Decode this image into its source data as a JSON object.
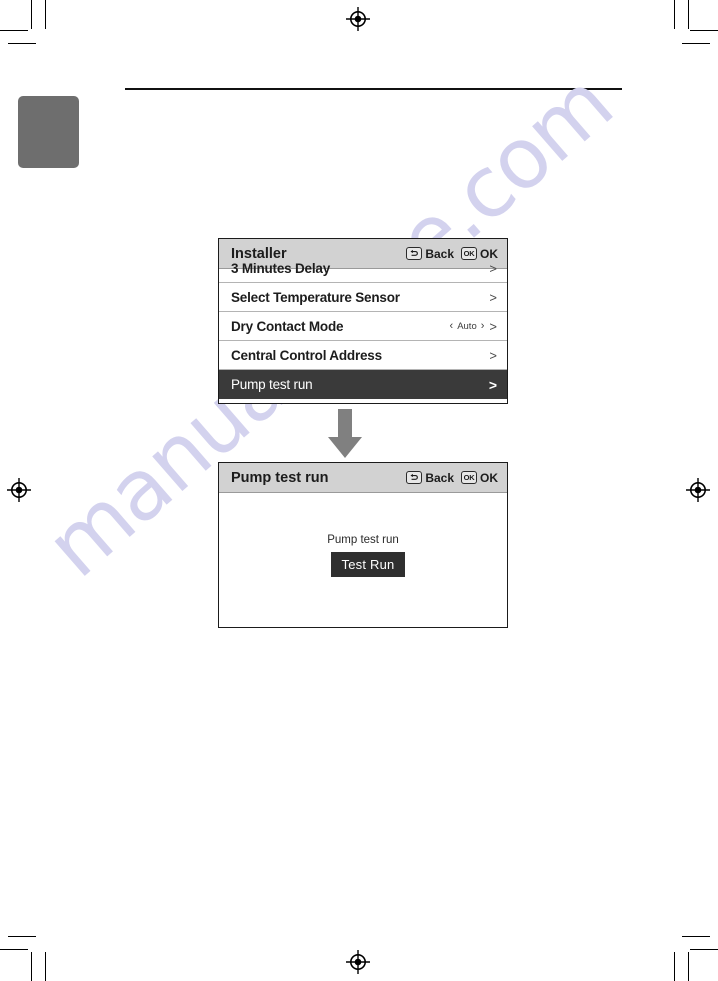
{
  "page": {
    "watermark_text": "manualshive.com",
    "watermark_color": "#d3d2ee",
    "chapter_tab_color": "#6e6e6e",
    "rule_color": "#111111"
  },
  "flow": {
    "arrow_direction": "down",
    "arrow_color": "#808080"
  },
  "screens": {
    "installer": {
      "title": "Installer",
      "actions": [
        {
          "icon": "back-icon",
          "label": "Back"
        },
        {
          "icon": "ok-icon",
          "label": "OK"
        }
      ],
      "rows": [
        {
          "label": "3 Minutes Delay",
          "value": "",
          "chevron": ">",
          "selected": false,
          "clipped": true
        },
        {
          "label": "Select Temperature Sensor",
          "value": "",
          "chevron": ">",
          "selected": false,
          "clipped": false
        },
        {
          "label": "Dry Contact Mode",
          "value": "Auto",
          "left_arrow": "‹",
          "right_arrow": "›",
          "chevron": ">",
          "selected": false,
          "clipped": false
        },
        {
          "label": "Central Control Address",
          "value": "",
          "chevron": ">",
          "selected": false,
          "clipped": false
        },
        {
          "label": "Pump test run",
          "value": "",
          "chevron": ">",
          "selected": true,
          "clipped": false
        }
      ]
    },
    "pump_test_run": {
      "title": "Pump test run",
      "actions": [
        {
          "icon": "back-icon",
          "label": "Back"
        },
        {
          "icon": "ok-icon",
          "label": "OK"
        }
      ],
      "caption": "Pump test run",
      "button_label": "Test Run",
      "button_color": "#2f2f2f"
    }
  },
  "icons": {
    "ok_badge_text": "OK",
    "registration_mark": "registration-target"
  }
}
